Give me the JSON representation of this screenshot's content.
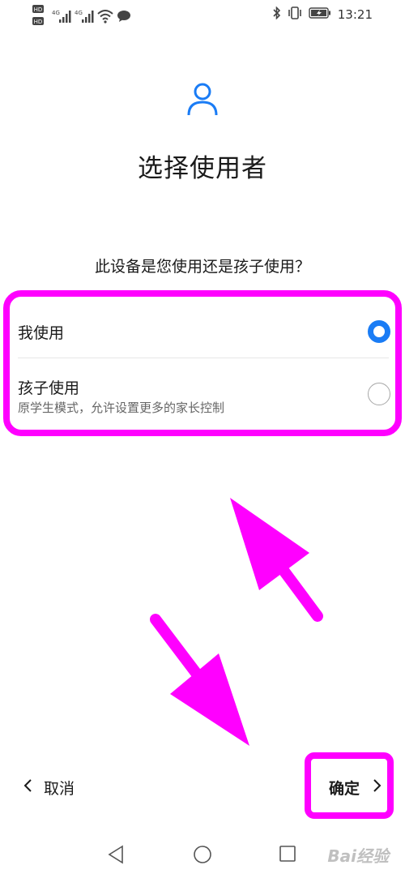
{
  "status_bar": {
    "time": "13:21",
    "left_icons": [
      "hd-icon",
      "signal-4g-icon",
      "signal-4g-icon",
      "wifi-icon",
      "message-bubble-icon"
    ],
    "right_icons": [
      "bluetooth-icon",
      "vibrate-icon",
      "battery-icon"
    ],
    "hd1": "HD",
    "hd2": "HD",
    "net1": "4G",
    "net2": "4G"
  },
  "header": {
    "title": "选择使用者",
    "icon": "user-icon"
  },
  "question": "此设备是您使用还是孩子使用？",
  "options": [
    {
      "label": "我使用",
      "sublabel": "",
      "selected": true
    },
    {
      "label": "孩子使用",
      "sublabel": "原学生模式，允许设置更多的家长控制",
      "selected": false
    }
  ],
  "actions": {
    "cancel_label": "取消",
    "confirm_label": "确定"
  },
  "nav": {
    "back_icon": "nav-back-icon",
    "home_icon": "nav-home-icon",
    "recent_icon": "nav-recent-icon"
  },
  "watermark": "Bai经验",
  "colors": {
    "accent": "#1a7cf5",
    "highlight": "#ff00ff",
    "text": "#1a1a1a",
    "subtext": "#666666"
  }
}
